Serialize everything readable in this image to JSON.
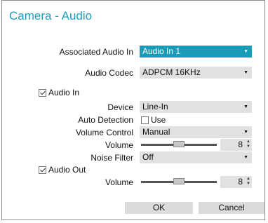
{
  "dialog": {
    "title": "Camera - Audio"
  },
  "associated_audio_in": {
    "label": "Associated Audio In",
    "value": "Audio In 1"
  },
  "audio_codec": {
    "label": "Audio Codec",
    "value": "ADPCM 16KHz"
  },
  "audio_in": {
    "label": "Audio In",
    "checked": true,
    "device": {
      "label": "Device",
      "value": "Line-In"
    },
    "auto_detection": {
      "label": "Auto Detection",
      "checkbox_label": "Use",
      "checked": false
    },
    "volume_control": {
      "label": "Volume Control",
      "value": "Manual"
    },
    "volume": {
      "label": "Volume",
      "value": "8",
      "slider_fraction": 0.5
    },
    "noise_filter": {
      "label": "Noise Filter",
      "value": "Off"
    }
  },
  "audio_out": {
    "label": "Audio Out",
    "checked": true,
    "volume": {
      "label": "Volume",
      "value": "8",
      "slider_fraction": 0.5
    }
  },
  "buttons": {
    "ok": "OK",
    "cancel": "Cancel"
  },
  "icons": {
    "dropdown": "chevron-down-icon",
    "spinner": "spinner-arrows-icon"
  },
  "colors": {
    "title": "#1aa0be",
    "accent": "#1a9bb8"
  }
}
